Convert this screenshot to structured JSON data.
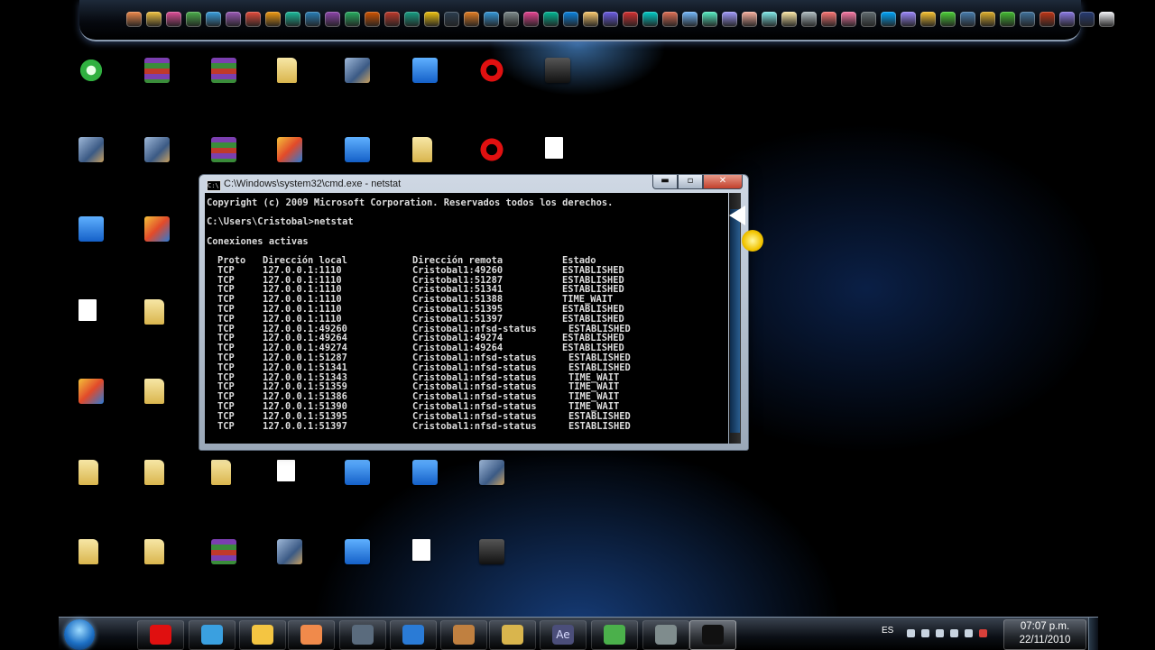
{
  "dock": {
    "colors": [
      "#f08a4b",
      "#f4c542",
      "#e04e9a",
      "#4bb04b",
      "#3aa0e0",
      "#9b59b6",
      "#e74c3c",
      "#f39c12",
      "#1abc9c",
      "#2980b9",
      "#8e44ad",
      "#27ae60",
      "#d35400",
      "#c0392b",
      "#16a085",
      "#f1c40f",
      "#2c3e50",
      "#e67e22",
      "#3498db",
      "#7f8c8d",
      "#e84393",
      "#00b894",
      "#0984e3",
      "#fdcb6e",
      "#6c5ce7",
      "#d63031",
      "#00cec9",
      "#e17055",
      "#74b9ff",
      "#55efc4",
      "#a29bfe",
      "#fab1a0",
      "#81ecec",
      "#ffeaa7",
      "#b2bec3",
      "#ff7675",
      "#fd79a8",
      "#636e72",
      "#00a8ff",
      "#9c88ff",
      "#fbc531",
      "#4cd137",
      "#487eb0",
      "#e1b12c",
      "#44bd32",
      "#40739e",
      "#c23616",
      "#8c7ae6",
      "#273c75",
      "#f5f6fa"
    ],
    "icons": [
      "app-icon"
    ]
  },
  "desktop_icons": [
    {
      "name": "app-green-shortcut-icon",
      "kind": "app-green"
    },
    {
      "name": "winrar-archive-icon",
      "kind": "rar"
    },
    {
      "name": "winrar-archive-icon",
      "kind": "rar"
    },
    {
      "name": "folder-icon",
      "kind": "folder"
    },
    {
      "name": "image-shortcut-icon",
      "kind": "img"
    },
    {
      "name": "network-shortcut-icon",
      "kind": "app-blue"
    },
    {
      "name": "opera-browser-icon",
      "kind": "opera"
    },
    {
      "name": "media-shortcut-icon",
      "kind": "app-dark"
    },
    {
      "name": "game-shortcut-icon",
      "kind": "img"
    },
    {
      "name": "image-file-icon",
      "kind": "img"
    },
    {
      "name": "winrar-archive-icon",
      "kind": "rar"
    },
    {
      "name": "program-shortcut-icon",
      "kind": "app-mixed"
    },
    {
      "name": "blue-app-icon",
      "kind": "app-blue"
    },
    {
      "name": "folder-icon",
      "kind": "folder"
    },
    {
      "name": "opera-browser-icon",
      "kind": "opera"
    },
    {
      "name": "text-document-icon",
      "kind": "doc"
    },
    {
      "name": "blue-app-icon",
      "kind": "app-blue"
    },
    {
      "name": "winrar-archive-icon",
      "kind": "app-mixed"
    },
    {
      "name": "text-document-icon",
      "kind": "doc"
    },
    {
      "name": "folder-icon",
      "kind": "folder"
    },
    {
      "name": "program-shortcut-icon",
      "kind": "app-mixed"
    },
    {
      "name": "folder-icon",
      "kind": "folder"
    },
    {
      "name": "folder-icon",
      "kind": "folder"
    },
    {
      "name": "folder-icon",
      "kind": "folder"
    },
    {
      "name": "folder-icon",
      "kind": "folder"
    },
    {
      "name": "text-document-icon",
      "kind": "doc"
    },
    {
      "name": "blue-app-icon",
      "kind": "app-blue"
    },
    {
      "name": "program-shortcut-icon",
      "kind": "app-blue"
    },
    {
      "name": "image-shortcut-icon",
      "kind": "img"
    },
    {
      "name": "folder-icon",
      "kind": "folder"
    },
    {
      "name": "folder-icon",
      "kind": "folder"
    },
    {
      "name": "winrar-archive-icon",
      "kind": "rar"
    },
    {
      "name": "image-shortcut-icon",
      "kind": "img"
    },
    {
      "name": "blue-app-icon",
      "kind": "app-blue"
    },
    {
      "name": "disc-app-icon",
      "kind": "doc"
    },
    {
      "name": "media-shortcut-icon",
      "kind": "app-dark"
    }
  ],
  "console": {
    "title": "C:\\Windows\\system32\\cmd.exe - netstat",
    "icon_text": "C:\\",
    "buttons": {
      "minimize": "▬",
      "maximize": "▫",
      "close": "✕"
    },
    "copyright": "Copyright (c) 2009 Microsoft Corporation. Reservados todos los derechos.",
    "prompt": "C:\\Users\\Cristobal>netstat",
    "section_title": "Conexiones activas",
    "headers": [
      "Proto",
      "Dirección local",
      "Dirección remota",
      "Estado"
    ],
    "rows": [
      [
        "TCP",
        "127.0.0.1:1110",
        "Cristobal1:49260",
        "ESTABLISHED"
      ],
      [
        "TCP",
        "127.0.0.1:1110",
        "Cristobal1:51287",
        "ESTABLISHED"
      ],
      [
        "TCP",
        "127.0.0.1:1110",
        "Cristobal1:51341",
        "ESTABLISHED"
      ],
      [
        "TCP",
        "127.0.0.1:1110",
        "Cristobal1:51388",
        "TIME_WAIT"
      ],
      [
        "TCP",
        "127.0.0.1:1110",
        "Cristobal1:51395",
        "ESTABLISHED"
      ],
      [
        "TCP",
        "127.0.0.1:1110",
        "Cristobal1:51397",
        "ESTABLISHED"
      ],
      [
        "TCP",
        "127.0.0.1:49260",
        "Cristobal1:nfsd-status",
        "ESTABLISHED"
      ],
      [
        "TCP",
        "127.0.0.1:49264",
        "Cristobal1:49274",
        "ESTABLISHED"
      ],
      [
        "TCP",
        "127.0.0.1:49274",
        "Cristobal1:49264",
        "ESTABLISHED"
      ],
      [
        "TCP",
        "127.0.0.1:51287",
        "Cristobal1:nfsd-status",
        "ESTABLISHED"
      ],
      [
        "TCP",
        "127.0.0.1:51341",
        "Cristobal1:nfsd-status",
        "ESTABLISHED"
      ],
      [
        "TCP",
        "127.0.0.1:51343",
        "Cristobal1:nfsd-status",
        "TIME_WAIT"
      ],
      [
        "TCP",
        "127.0.0.1:51359",
        "Cristobal1:nfsd-status",
        "TIME_WAIT"
      ],
      [
        "TCP",
        "127.0.0.1:51386",
        "Cristobal1:nfsd-status",
        "TIME_WAIT"
      ],
      [
        "TCP",
        "127.0.0.1:51390",
        "Cristobal1:nfsd-status",
        "TIME_WAIT"
      ],
      [
        "TCP",
        "127.0.0.1:51395",
        "Cristobal1:nfsd-status",
        "ESTABLISHED"
      ],
      [
        "TCP",
        "127.0.0.1:51397",
        "Cristobal1:nfsd-status",
        "ESTABLISHED"
      ]
    ]
  },
  "taskbar": {
    "buttons": [
      {
        "name": "opera-taskbar-button",
        "color": "#e01010"
      },
      {
        "name": "messenger-taskbar-button",
        "color": "#3aa0e0"
      },
      {
        "name": "explorer-taskbar-button",
        "color": "#f4c542"
      },
      {
        "name": "media-player-taskbar-button",
        "color": "#f08a4b"
      },
      {
        "name": "mail-taskbar-button",
        "color": "#5a6b7d"
      },
      {
        "name": "photoshop-taskbar-button",
        "color": "#2a7bd6"
      },
      {
        "name": "app-taskbar-button",
        "color": "#c08040"
      },
      {
        "name": "winrar-taskbar-button",
        "color": "#d9b54d"
      },
      {
        "name": "after-effects-taskbar-button",
        "color": "#4b4e7a"
      },
      {
        "name": "green-app-taskbar-button",
        "color": "#4bb04b"
      },
      {
        "name": "tool-taskbar-button",
        "color": "#7f8c8d"
      },
      {
        "name": "cmd-taskbar-button",
        "color": "#111111"
      }
    ],
    "ae_label": "Ae",
    "language": "ES",
    "time": "07:07 p.m.",
    "date": "22/11/2010"
  }
}
